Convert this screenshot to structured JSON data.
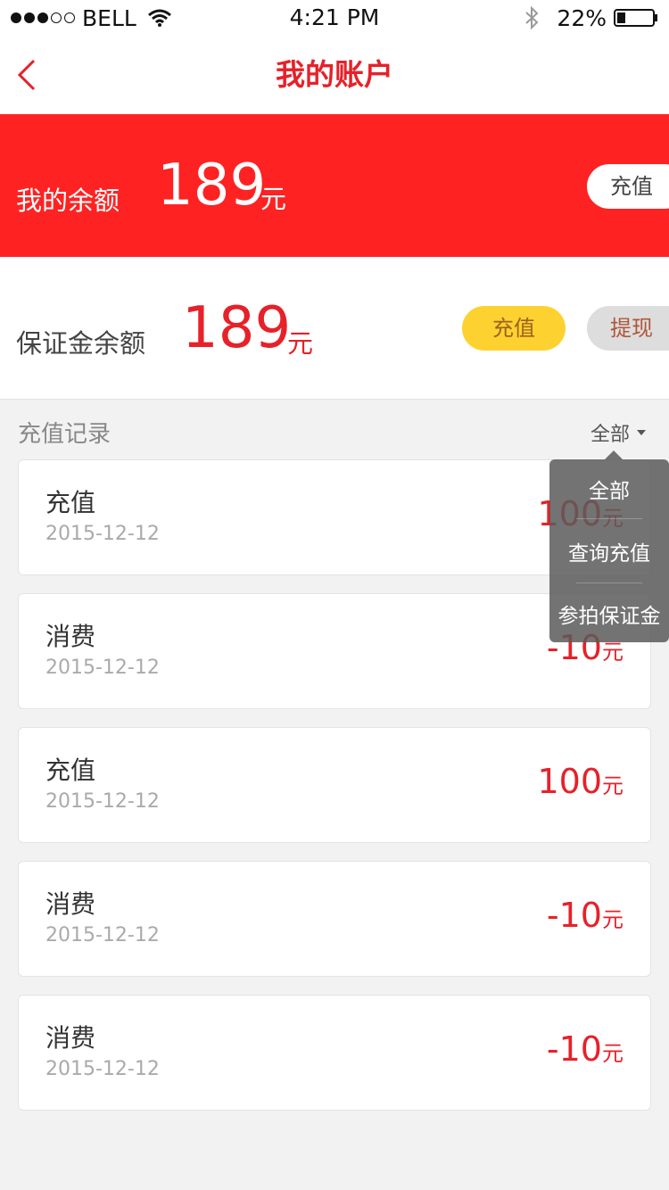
{
  "status_bar": {
    "carrier": "BELL",
    "time": "4:21 PM",
    "battery": "22%"
  },
  "nav": {
    "title": "我的账户"
  },
  "balance": {
    "label": "我的余额",
    "amount": "189",
    "unit": "元",
    "recharge_label": "充值"
  },
  "deposit": {
    "label": "保证金余额",
    "amount": "189",
    "unit": "元",
    "recharge_label": "充值",
    "withdraw_label": "提现"
  },
  "records": {
    "title": "充值记录",
    "filter_label": "全部",
    "items": [
      {
        "type": "充值",
        "date": "2015-12-12",
        "amount": "100",
        "unit": "元"
      },
      {
        "type": "消费",
        "date": "2015-12-12",
        "amount": "-10",
        "unit": "元"
      },
      {
        "type": "充值",
        "date": "2015-12-12",
        "amount": "100",
        "unit": "元"
      },
      {
        "type": "消费",
        "date": "2015-12-12",
        "amount": "-10",
        "unit": "元"
      },
      {
        "type": "消费",
        "date": "2015-12-12",
        "amount": "-10",
        "unit": "元"
      }
    ]
  },
  "filter_menu": {
    "options": [
      "全部",
      "查询充值",
      "参拍保证金"
    ]
  },
  "colors": {
    "brand_red": "#e62129",
    "banner_red": "#ff2222",
    "yellow_button": "#fdd230"
  }
}
